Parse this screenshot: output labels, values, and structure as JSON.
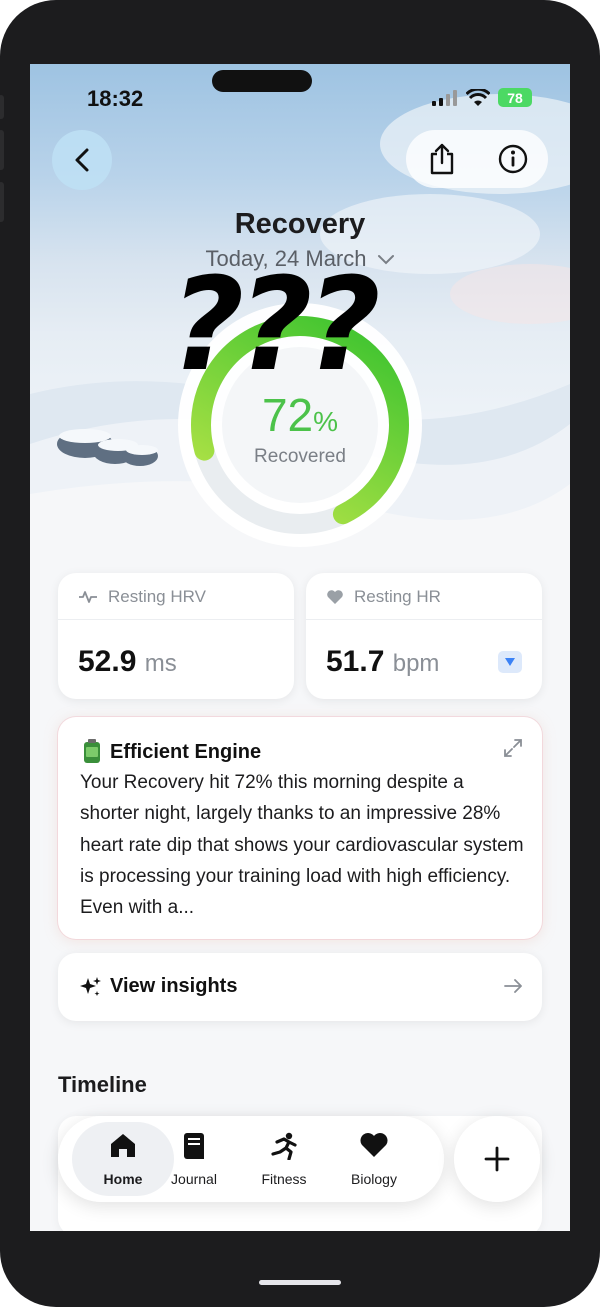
{
  "status_bar": {
    "time": "18:32",
    "battery": "78"
  },
  "header": {
    "title": "Recovery",
    "date": "Today, 24 March"
  },
  "redaction": "???",
  "recovery": {
    "value": "72",
    "unit": "%",
    "label": "Recovered",
    "fraction": 0.72
  },
  "metrics": {
    "hrv": {
      "label": "Resting HRV",
      "value": "52.9",
      "unit": "ms"
    },
    "hr": {
      "label": "Resting HR",
      "value": "51.7",
      "unit": "bpm"
    }
  },
  "insight": {
    "title": "Efficient Engine",
    "body": "Your Recovery hit 72% this morning despite a shorter night, largely thanks to an impressive 28% heart rate dip that shows your cardiovascular system is processing your training load with high efficiency. Even with a..."
  },
  "view_insights": {
    "label": "View insights"
  },
  "timeline": {
    "title": "Timeline"
  },
  "tabs": [
    {
      "label": "Home",
      "icon": "home-icon"
    },
    {
      "label": "Journal",
      "icon": "journal-icon"
    },
    {
      "label": "Fitness",
      "icon": "fitness-icon"
    },
    {
      "label": "Biology",
      "icon": "heart-icon"
    }
  ],
  "colors": {
    "accent_green": "#4cc24a",
    "ring_start": "#34c12e",
    "ring_end": "#c6e84a"
  }
}
